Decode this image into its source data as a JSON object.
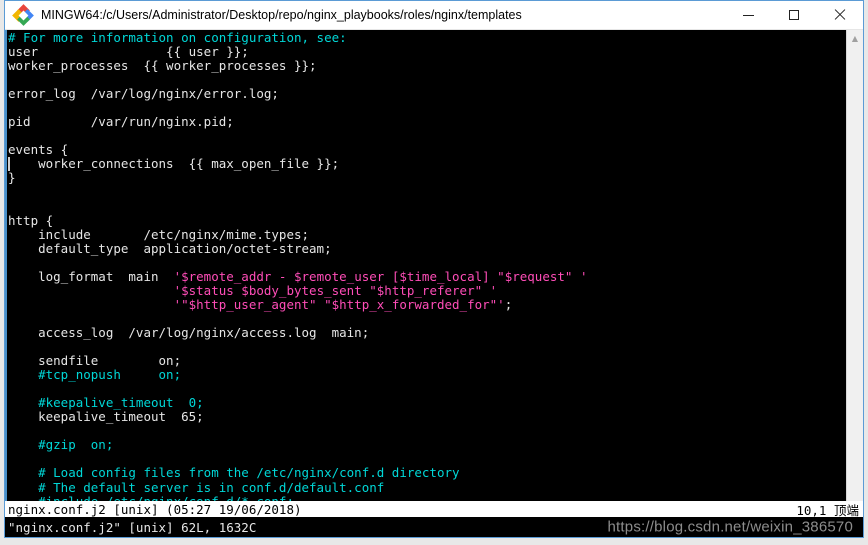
{
  "window": {
    "title": "MINGW64:/c/Users/Administrator/Desktop/repo/nginx_playbooks/roles/nginx/templates",
    "icon": "mingw-diamond-icon",
    "controls": {
      "minimize": "—",
      "maximize": "□",
      "close": "✕"
    },
    "border_color": "#5b9bd5"
  },
  "terminal": {
    "background": "#000000",
    "colors": {
      "comment": "#00d7d7",
      "normal": "#e6e6e6",
      "string": "#ff4db8",
      "tilde": "#3a6ea5",
      "left_edge": "#4a90c8"
    },
    "lines": [
      {
        "segments": [
          {
            "text": "# For more information on configuration, see:",
            "color": "comment"
          }
        ]
      },
      {
        "segments": [
          {
            "text": "user                 {{ user }};",
            "color": "normal"
          }
        ]
      },
      {
        "segments": [
          {
            "text": "worker_processes  {{ worker_processes }};",
            "color": "normal"
          }
        ]
      },
      {
        "segments": [
          {
            "text": "",
            "color": "normal"
          }
        ]
      },
      {
        "segments": [
          {
            "text": "error_log  /var/log/nginx/error.log;",
            "color": "normal"
          }
        ]
      },
      {
        "segments": [
          {
            "text": "",
            "color": "normal"
          }
        ]
      },
      {
        "segments": [
          {
            "text": "pid        /var/run/nginx.pid;",
            "color": "normal"
          }
        ]
      },
      {
        "segments": [
          {
            "text": "",
            "color": "normal"
          }
        ]
      },
      {
        "segments": [
          {
            "text": "events {",
            "color": "normal"
          }
        ]
      },
      {
        "segments": [
          {
            "text": "    worker_connections  {{ max_open_file }};",
            "color": "normal"
          }
        ]
      },
      {
        "segments": [
          {
            "text": "}",
            "color": "normal"
          }
        ]
      },
      {
        "segments": [
          {
            "text": "",
            "color": "normal"
          }
        ]
      },
      {
        "segments": [
          {
            "text": "",
            "color": "normal"
          }
        ]
      },
      {
        "segments": [
          {
            "text": "http {",
            "color": "normal"
          }
        ]
      },
      {
        "segments": [
          {
            "text": "    include       /etc/nginx/mime.types;",
            "color": "normal"
          }
        ]
      },
      {
        "segments": [
          {
            "text": "    default_type  application/octet-stream;",
            "color": "normal"
          }
        ]
      },
      {
        "segments": [
          {
            "text": "",
            "color": "normal"
          }
        ]
      },
      {
        "segments": [
          {
            "text": "    log_format  main  ",
            "color": "normal"
          },
          {
            "text": "'$remote_addr - $remote_user [$time_local] \"$request\" '",
            "color": "string"
          }
        ]
      },
      {
        "segments": [
          {
            "text": "                      ",
            "color": "normal"
          },
          {
            "text": "'$status $body_bytes_sent \"$http_referer\" '",
            "color": "string"
          }
        ]
      },
      {
        "segments": [
          {
            "text": "                      ",
            "color": "normal"
          },
          {
            "text": "'\"$http_user_agent\" \"$http_x_forwarded_for\"'",
            "color": "string"
          },
          {
            "text": ";",
            "color": "normal"
          }
        ]
      },
      {
        "segments": [
          {
            "text": "",
            "color": "normal"
          }
        ]
      },
      {
        "segments": [
          {
            "text": "    access_log  /var/log/nginx/access.log  main;",
            "color": "normal"
          }
        ]
      },
      {
        "segments": [
          {
            "text": "",
            "color": "normal"
          }
        ]
      },
      {
        "segments": [
          {
            "text": "    sendfile        on;",
            "color": "normal"
          }
        ]
      },
      {
        "segments": [
          {
            "text": "    #tcp_nopush     on;",
            "color": "comment"
          }
        ]
      },
      {
        "segments": [
          {
            "text": "",
            "color": "normal"
          }
        ]
      },
      {
        "segments": [
          {
            "text": "    #keepalive_timeout  0;",
            "color": "comment"
          }
        ]
      },
      {
        "segments": [
          {
            "text": "    keepalive_timeout  65;",
            "color": "normal"
          }
        ]
      },
      {
        "segments": [
          {
            "text": "",
            "color": "normal"
          }
        ]
      },
      {
        "segments": [
          {
            "text": "    #gzip  on;",
            "color": "comment"
          }
        ]
      },
      {
        "segments": [
          {
            "text": "",
            "color": "normal"
          }
        ]
      },
      {
        "segments": [
          {
            "text": "    # Load config files from the /etc/nginx/conf.d directory",
            "color": "comment"
          }
        ]
      },
      {
        "segments": [
          {
            "text": "    # The default server is in conf.d/default.conf",
            "color": "comment"
          }
        ]
      },
      {
        "segments": [
          {
            "text": "    #include /etc/nginx/conf.d/*.conf;",
            "color": "comment"
          }
        ]
      }
    ],
    "cursor": {
      "line_index": 9,
      "column_index": 0
    }
  },
  "scrollbar": {
    "up_arrow": "▲",
    "down_arrow": "▼"
  },
  "vim": {
    "statusline": {
      "left": "nginx.conf.j2 [unix] (05:27 19/06/2018)",
      "right": "10,1 顶端"
    },
    "cmdline": "\"nginx.conf.j2\" [unix] 62L, 1632C"
  },
  "watermark": {
    "text": "https://blog.csdn.net/weixin_386570"
  }
}
